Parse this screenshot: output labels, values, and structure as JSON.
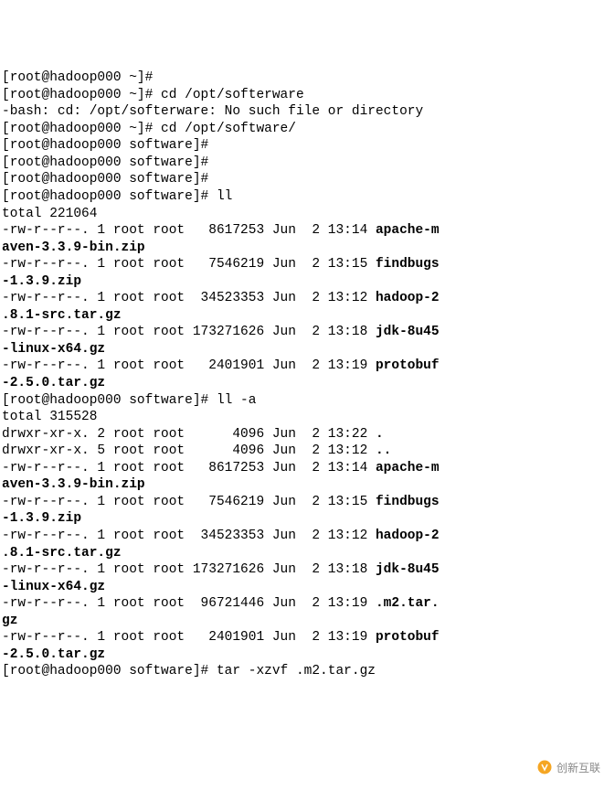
{
  "lines": [
    {
      "segments": [
        {
          "t": "[root@hadoop000 ~]#"
        }
      ]
    },
    {
      "segments": [
        {
          "t": "[root@hadoop000 ~]# cd /opt/softerware"
        }
      ]
    },
    {
      "segments": [
        {
          "t": "-bash: cd: /opt/softerware: No such file or directory"
        }
      ]
    },
    {
      "segments": [
        {
          "t": "[root@hadoop000 ~]# cd /opt/software/"
        }
      ]
    },
    {
      "segments": [
        {
          "t": "[root@hadoop000 software]#"
        }
      ]
    },
    {
      "segments": [
        {
          "t": "[root@hadoop000 software]#"
        }
      ]
    },
    {
      "segments": [
        {
          "t": "[root@hadoop000 software]#"
        }
      ]
    },
    {
      "segments": [
        {
          "t": "[root@hadoop000 software]# ll"
        }
      ]
    },
    {
      "segments": [
        {
          "t": "total 221064"
        }
      ]
    },
    {
      "segments": [
        {
          "t": "-rw-r--r--. 1 root root   8617253 Jun  2 13:14 "
        },
        {
          "t": "apache-m",
          "b": true
        }
      ]
    },
    {
      "segments": [
        {
          "t": "aven-3.3.9-bin.zip",
          "b": true
        }
      ]
    },
    {
      "segments": [
        {
          "t": "-rw-r--r--. 1 root root   7546219 Jun  2 13:15 "
        },
        {
          "t": "findbugs",
          "b": true
        }
      ]
    },
    {
      "segments": [
        {
          "t": "-1.3.9.zip",
          "b": true
        }
      ]
    },
    {
      "segments": [
        {
          "t": "-rw-r--r--. 1 root root  34523353 Jun  2 13:12 "
        },
        {
          "t": "hadoop-2",
          "b": true
        }
      ]
    },
    {
      "segments": [
        {
          "t": ".8.1-src.tar.gz",
          "b": true
        }
      ]
    },
    {
      "segments": [
        {
          "t": "-rw-r--r--. 1 root root 173271626 Jun  2 13:18 "
        },
        {
          "t": "jdk-8u45",
          "b": true
        }
      ]
    },
    {
      "segments": [
        {
          "t": "-linux-x64.gz",
          "b": true
        }
      ]
    },
    {
      "segments": [
        {
          "t": "-rw-r--r--. 1 root root   2401901 Jun  2 13:19 "
        },
        {
          "t": "protobuf",
          "b": true
        }
      ]
    },
    {
      "segments": [
        {
          "t": "-2.5.0.tar.gz",
          "b": true
        }
      ]
    },
    {
      "segments": [
        {
          "t": "[root@hadoop000 software]# ll -a"
        }
      ]
    },
    {
      "segments": [
        {
          "t": "total 315528"
        }
      ]
    },
    {
      "segments": [
        {
          "t": "drwxr-xr-x. 2 root root      4096 Jun  2 13:22 "
        },
        {
          "t": ".",
          "b": true
        }
      ]
    },
    {
      "segments": [
        {
          "t": "drwxr-xr-x. 5 root root      4096 Jun  2 13:12 "
        },
        {
          "t": "..",
          "b": true
        }
      ]
    },
    {
      "segments": [
        {
          "t": "-rw-r--r--. 1 root root   8617253 Jun  2 13:14 "
        },
        {
          "t": "apache-m",
          "b": true
        }
      ]
    },
    {
      "segments": [
        {
          "t": "aven-3.3.9-bin.zip",
          "b": true
        }
      ]
    },
    {
      "segments": [
        {
          "t": "-rw-r--r--. 1 root root   7546219 Jun  2 13:15 "
        },
        {
          "t": "findbugs",
          "b": true
        }
      ]
    },
    {
      "segments": [
        {
          "t": "-1.3.9.zip",
          "b": true
        }
      ]
    },
    {
      "segments": [
        {
          "t": "-rw-r--r--. 1 root root  34523353 Jun  2 13:12 "
        },
        {
          "t": "hadoop-2",
          "b": true
        }
      ]
    },
    {
      "segments": [
        {
          "t": ".8.1-src.tar.gz",
          "b": true
        }
      ]
    },
    {
      "segments": [
        {
          "t": "-rw-r--r--. 1 root root 173271626 Jun  2 13:18 "
        },
        {
          "t": "jdk-8u45",
          "b": true
        }
      ]
    },
    {
      "segments": [
        {
          "t": "-linux-x64.gz",
          "b": true
        }
      ]
    },
    {
      "segments": [
        {
          "t": "-rw-r--r--. 1 root root  96721446 Jun  2 13:19 "
        },
        {
          "t": ".m2.tar.",
          "b": true
        }
      ]
    },
    {
      "segments": [
        {
          "t": "gz",
          "b": true
        }
      ]
    },
    {
      "segments": [
        {
          "t": "-rw-r--r--. 1 root root   2401901 Jun  2 13:19 "
        },
        {
          "t": "protobuf",
          "b": true
        }
      ]
    },
    {
      "segments": [
        {
          "t": "-2.5.0.tar.gz",
          "b": true
        }
      ]
    },
    {
      "segments": [
        {
          "t": "[root@hadoop000 software]# tar -xzvf .m2.tar.gz"
        }
      ]
    }
  ],
  "watermark": "创新互联"
}
